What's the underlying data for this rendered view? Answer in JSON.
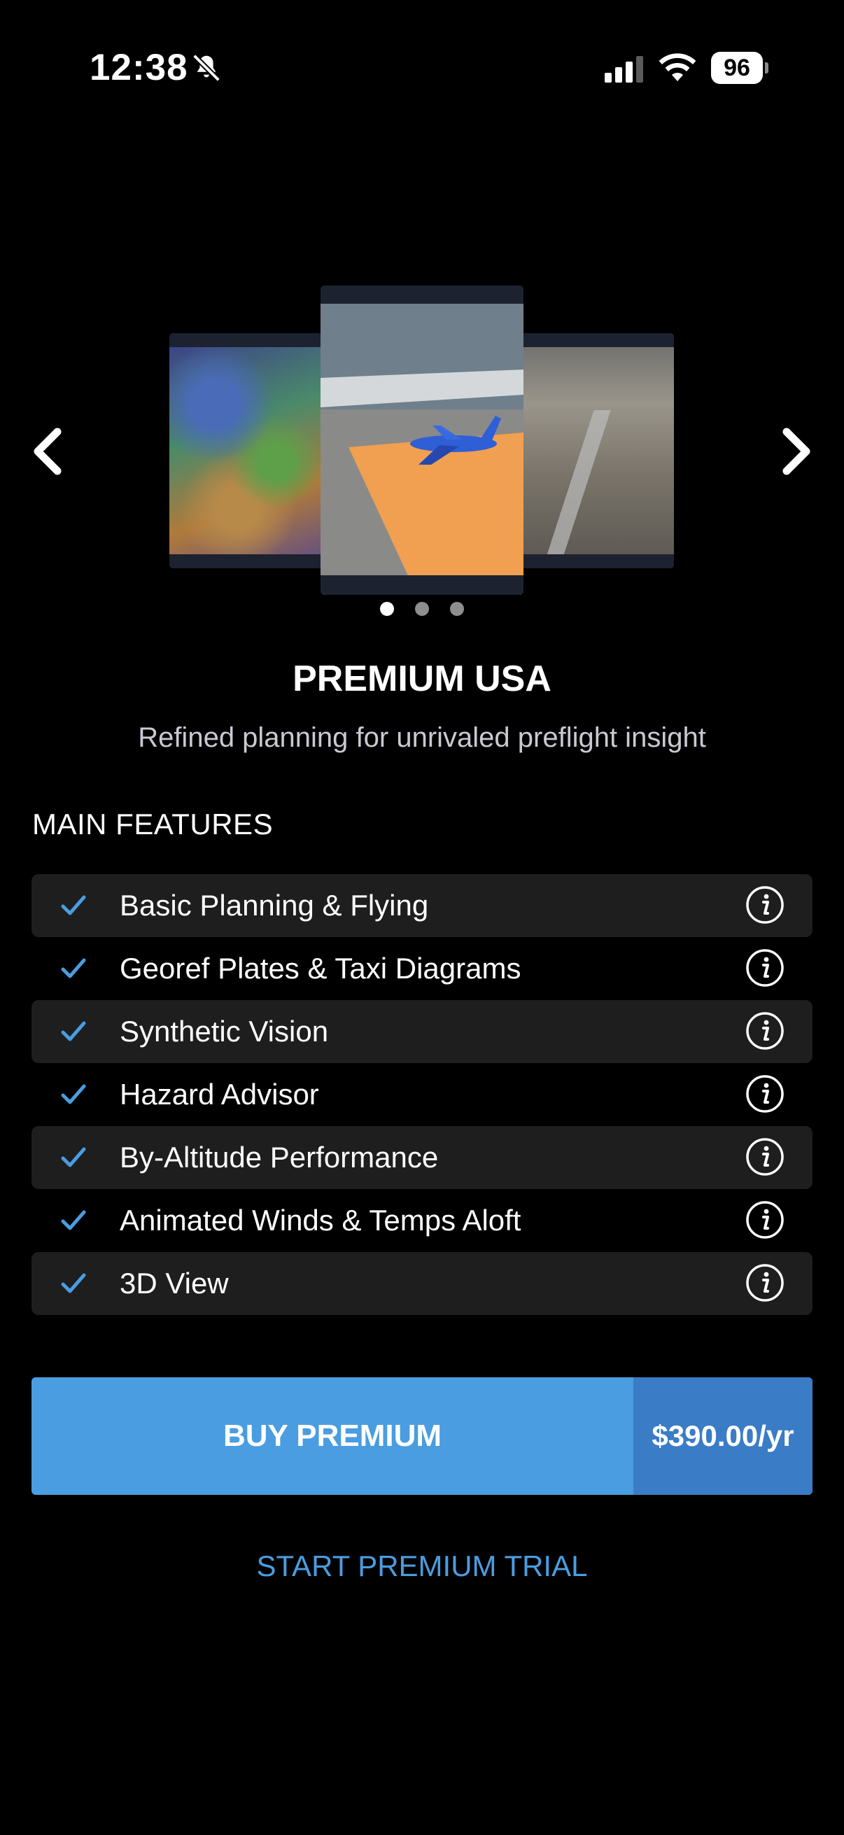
{
  "status_bar": {
    "time": "12:38",
    "battery": "96",
    "icons": [
      "bell-slash-icon",
      "cellular-signal-icon",
      "wifi-icon",
      "battery-icon"
    ]
  },
  "carousel": {
    "slides": [
      "screenshot-winds-aloft",
      "screenshot-3d-view",
      "screenshot-runway"
    ],
    "active_index": 0,
    "total": 3,
    "icons": [
      "chevron-left-icon",
      "chevron-right-icon"
    ]
  },
  "plan": {
    "title": "PREMIUM USA",
    "subtitle": "Refined planning for unrivaled preflight insight"
  },
  "features": {
    "heading": "MAIN FEATURES",
    "items": [
      {
        "label": "Basic Planning & Flying"
      },
      {
        "label": "Georef Plates & Taxi Diagrams"
      },
      {
        "label": "Synthetic Vision"
      },
      {
        "label": "Hazard Advisor"
      },
      {
        "label": "By-Altitude Performance"
      },
      {
        "label": "Animated Winds & Temps Aloft"
      },
      {
        "label": "3D View"
      }
    ]
  },
  "purchase": {
    "buy_label": "BUY PREMIUM",
    "price": "$390.00/yr",
    "trial_label": "START PREMIUM TRIAL"
  },
  "colors": {
    "accent": "#4a9de0",
    "accent_dark": "#3a7cc6",
    "row_shade": "#1e1e1f",
    "background": "#000000"
  }
}
